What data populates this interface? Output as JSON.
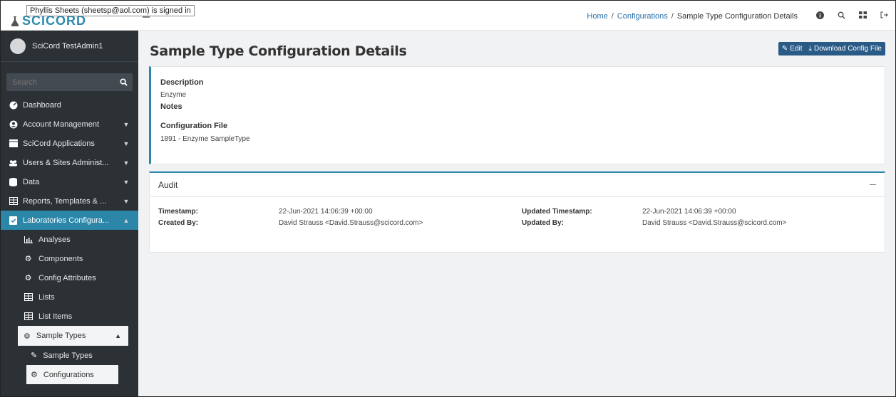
{
  "app": {
    "logo_text": "SCICORD",
    "signed_in_tooltip": "Phyllis Sheets (sheetsp@aol.com) is signed in"
  },
  "user": {
    "name": "SciCord TestAdmin1"
  },
  "search": {
    "placeholder": "Search"
  },
  "sidebar": {
    "items": [
      {
        "label": "Dashboard",
        "icon": "dashboard-icon"
      },
      {
        "label": "Account Management",
        "icon": "user-circle-icon"
      },
      {
        "label": "SciCord Applications",
        "icon": "applications-icon"
      },
      {
        "label": "Users & Sites Administ...",
        "icon": "users-icon"
      },
      {
        "label": "Data",
        "icon": "database-icon"
      },
      {
        "label": "Reports, Templates & ...",
        "icon": "table-icon"
      },
      {
        "label": "Laboratories Configura...",
        "icon": "clipboard-check-icon"
      }
    ],
    "lab_sub": [
      {
        "label": "Analyses",
        "icon": "chart-icon"
      },
      {
        "label": "Components",
        "icon": "cogs-icon"
      },
      {
        "label": "Config Attributes",
        "icon": "cog-icon"
      },
      {
        "label": "Lists",
        "icon": "table-icon"
      },
      {
        "label": "List Items",
        "icon": "table-icon"
      }
    ],
    "sample_types": {
      "label": "Sample Types",
      "icon": "cog-icon"
    },
    "sample_sub": [
      {
        "label": "Sample Types",
        "icon": "pencil-icon"
      },
      {
        "label": "Configurations",
        "icon": "cogs-icon"
      }
    ]
  },
  "breadcrumb": {
    "home": "Home",
    "configurations": "Configurations",
    "current": "Sample Type Configuration Details",
    "sep": "/"
  },
  "page": {
    "title": "Sample Type Configuration Details",
    "edit_label": "Edit",
    "download_label": "Download Config File"
  },
  "details": {
    "description_label": "Description",
    "description_value": "Enzyme",
    "notes_label": "Notes",
    "config_file_label": "Configuration File",
    "config_file_value": "1891 - Enzyme SampleType"
  },
  "audit": {
    "title": "Audit",
    "timestamp_label": "Timestamp:",
    "timestamp_value": "22-Jun-2021 14:06:39 +00:00",
    "updated_timestamp_label": "Updated Timestamp:",
    "updated_timestamp_value": "22-Jun-2021 14:06:39 +00:00",
    "created_by_label": "Created By:",
    "created_by_value": "David Strauss <David.Strauss@scicord.com>",
    "updated_by_label": "Updated By:",
    "updated_by_value": "David Strauss <David.Strauss@scicord.com>"
  },
  "colors": {
    "accent": "#2b86a8",
    "sidebar_bg": "#2c3136",
    "button_bg": "#2a5b87",
    "link": "#2b6fa8"
  }
}
